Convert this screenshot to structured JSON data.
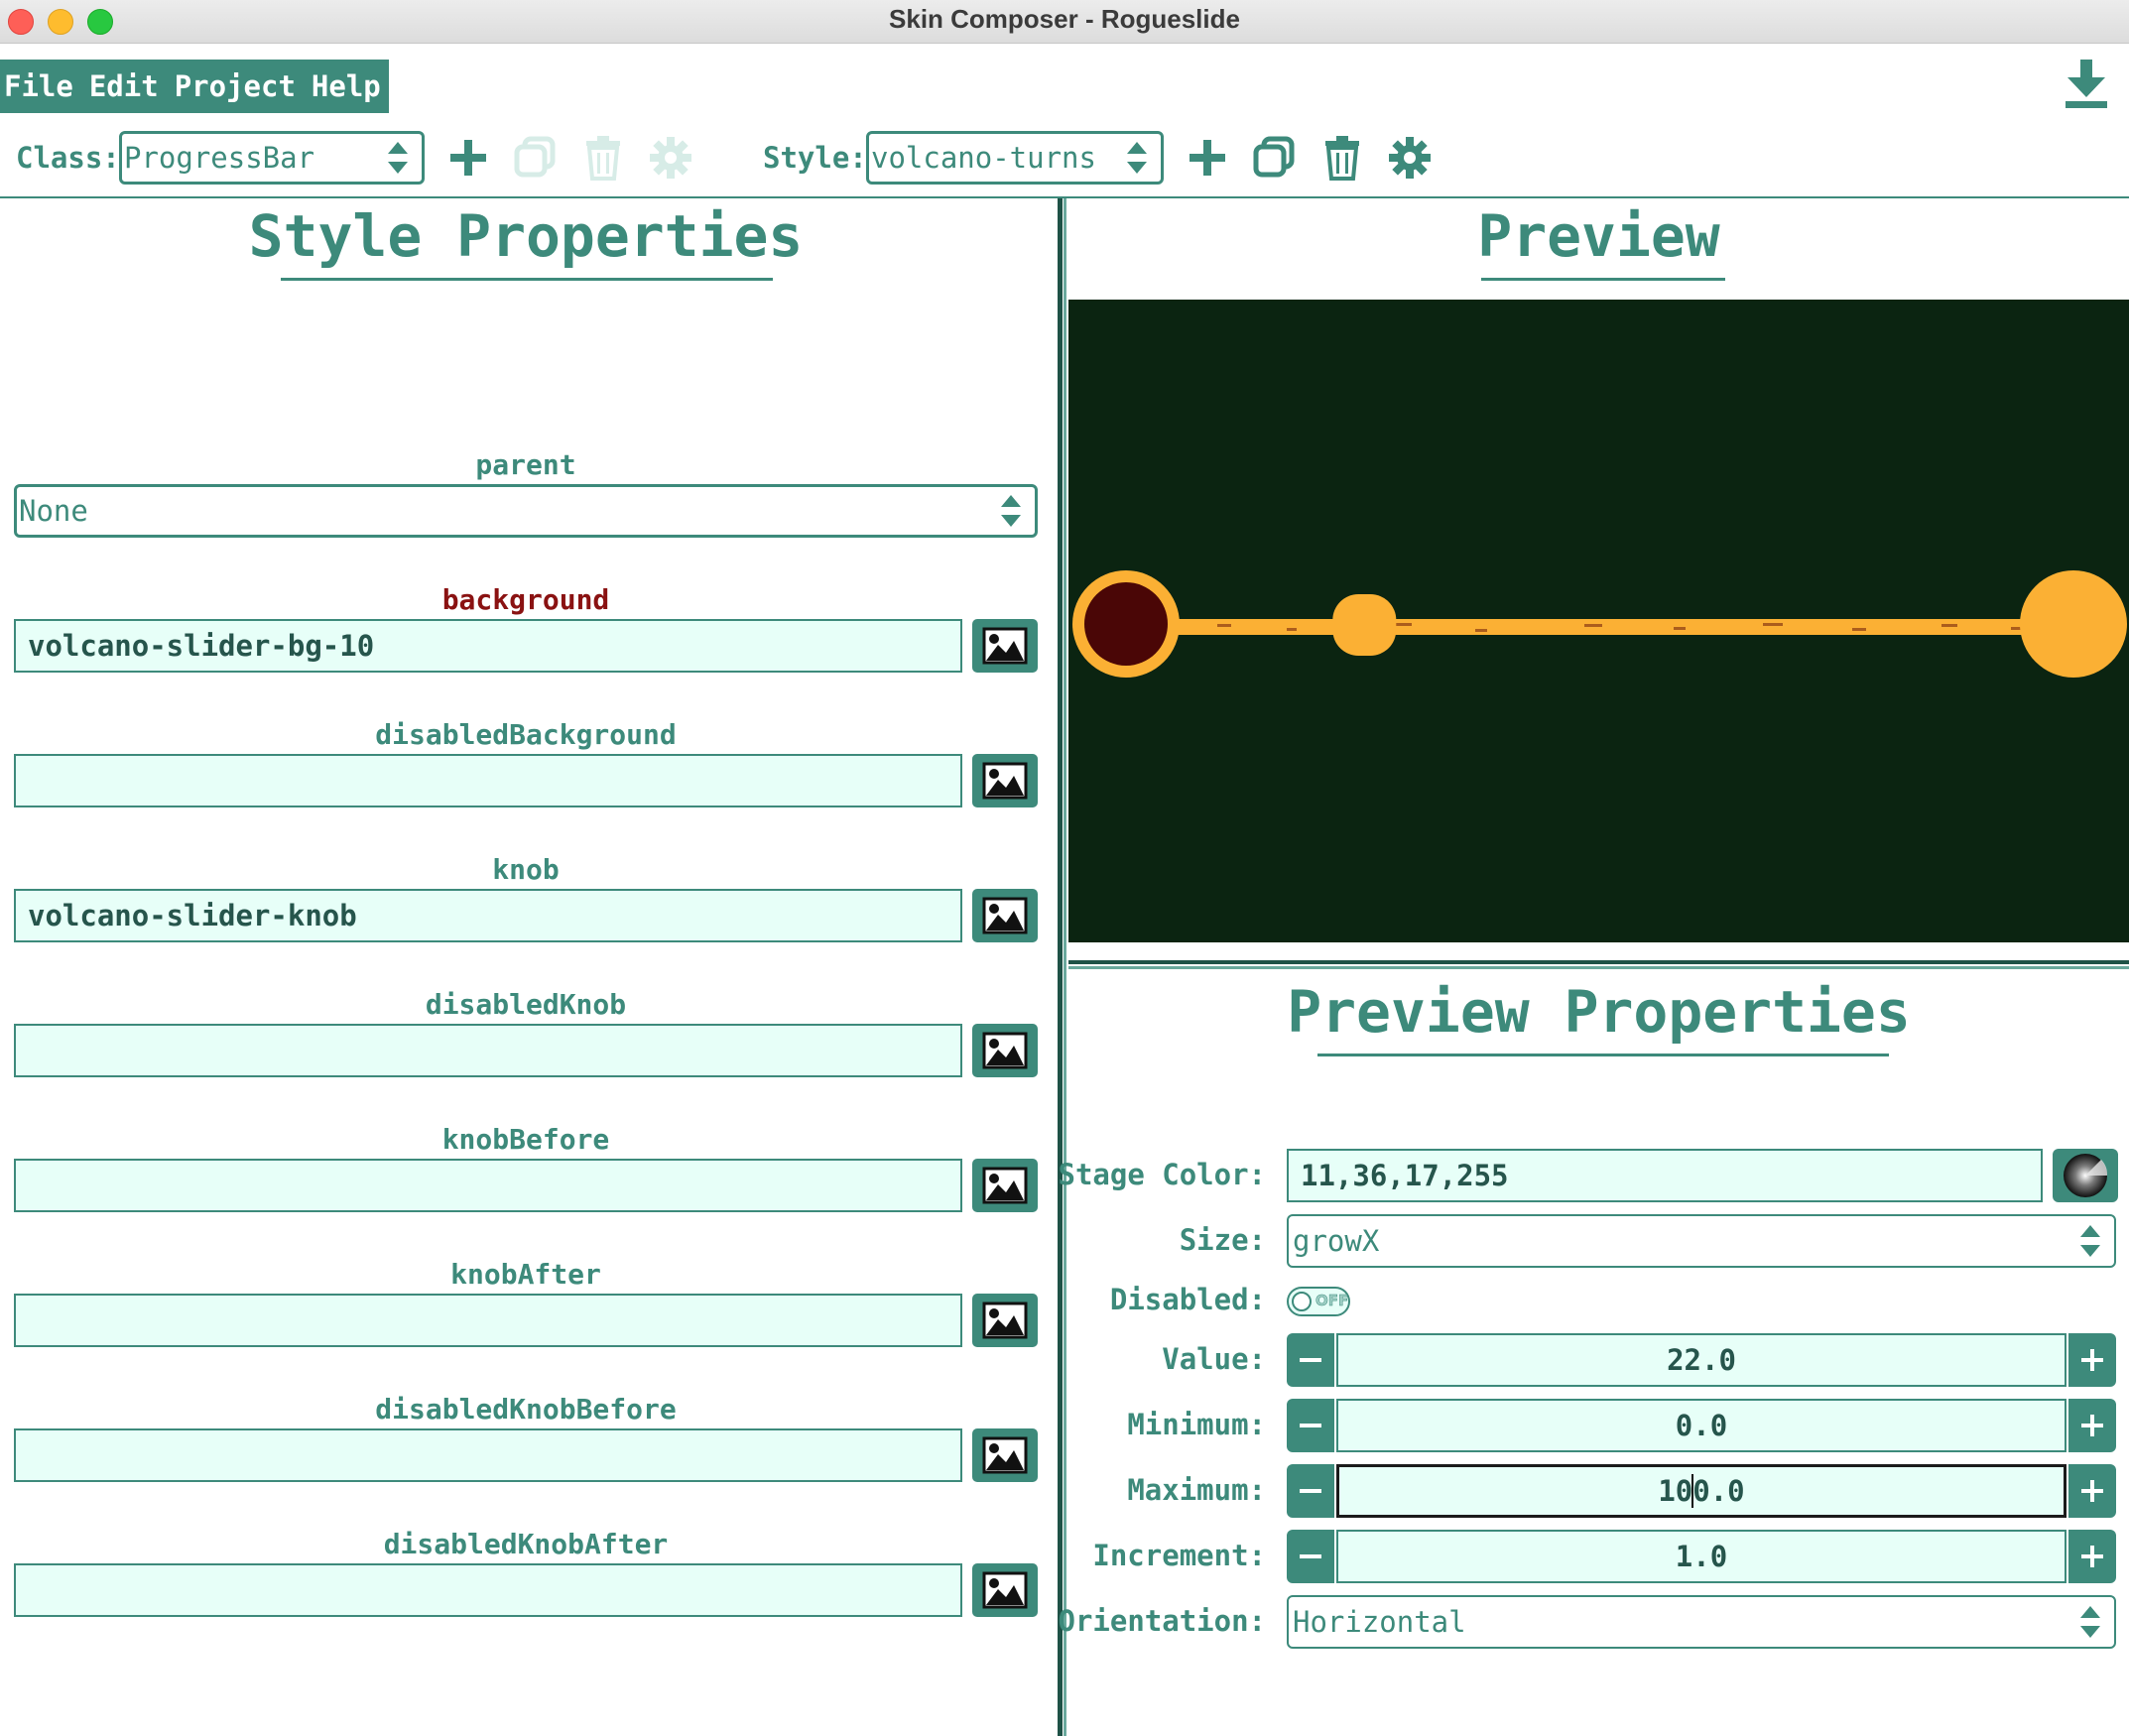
{
  "window": {
    "title": "Skin Composer - Rogueslide"
  },
  "menu": {
    "items": [
      "File",
      "Edit",
      "Project",
      "Help"
    ]
  },
  "toolbar": {
    "class_label": "Class:",
    "class_value": "ProgressBar",
    "style_label": "Style:",
    "style_value": "volcano-turns"
  },
  "style_properties": {
    "title": "Style Properties",
    "parent_label": "parent",
    "parent_value": "None",
    "fields": [
      {
        "label": "background",
        "value": "volcano-slider-bg-10",
        "required": true
      },
      {
        "label": "disabledBackground",
        "value": ""
      },
      {
        "label": "knob",
        "value": "volcano-slider-knob"
      },
      {
        "label": "disabledKnob",
        "value": ""
      },
      {
        "label": "knobBefore",
        "value": ""
      },
      {
        "label": "knobAfter",
        "value": ""
      },
      {
        "label": "disabledKnobBefore",
        "value": ""
      },
      {
        "label": "disabledKnobAfter",
        "value": ""
      }
    ]
  },
  "preview": {
    "title": "Preview",
    "stage_color": "#0b2411",
    "slider_value": 22.0,
    "slider_min": 0.0,
    "slider_max": 100.0
  },
  "preview_properties": {
    "title": "Preview Properties",
    "stage_color_label": "Stage Color:",
    "stage_color_value": "11,36,17,255",
    "size_label": "Size:",
    "size_value": "growX",
    "disabled_label": "Disabled:",
    "disabled_value": "OFF",
    "value_label": "Value:",
    "value_value": "22.0",
    "minimum_label": "Minimum:",
    "minimum_value": "0.0",
    "maximum_label": "Maximum:",
    "maximum_before_caret": "10",
    "maximum_after_caret": "0.0",
    "increment_label": "Increment:",
    "increment_value": "1.0",
    "orientation_label": "Orientation:",
    "orientation_value": "Horizontal"
  },
  "colors": {
    "accent": "#3d8a7b",
    "field_bg": "#e7fff8",
    "required_label": "#8a1212",
    "slider_orange": "#fbb034",
    "knob_dark": "#4a0606"
  }
}
